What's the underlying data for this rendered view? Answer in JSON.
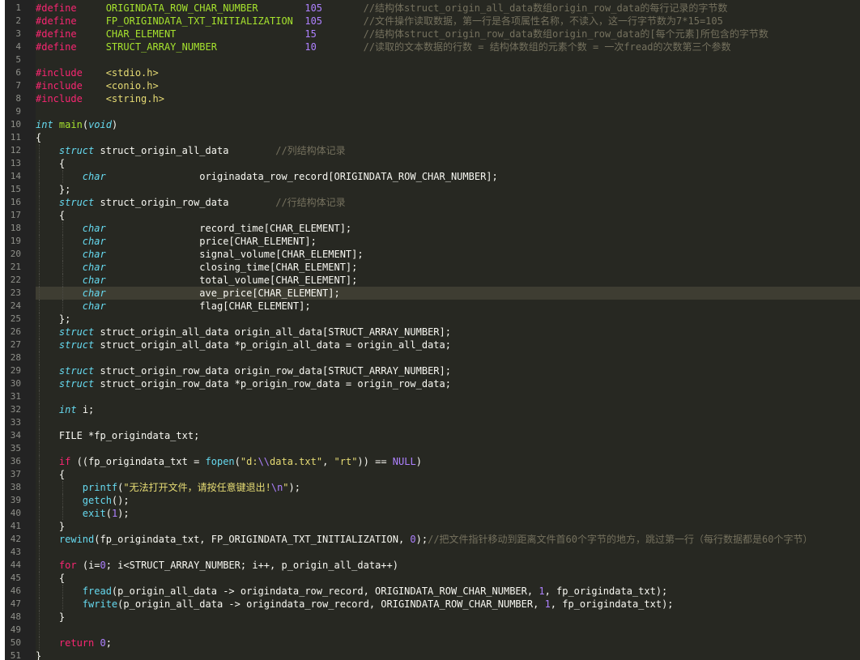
{
  "editor": {
    "highlighted_line": 23,
    "theme_colors": {
      "background": "#272822",
      "gutter": "#232323",
      "line_number": "#8f908a",
      "keyword": "#f92672",
      "type": "#66d9ef",
      "macro": "#a6e22e",
      "number": "#ae81ff",
      "string": "#e6db74",
      "comment": "#75715e",
      "text": "#f8f8f2"
    },
    "lines": [
      {
        "n": "1",
        "indent": 0,
        "tokens": [
          {
            "t": "k",
            "v": "#define"
          },
          {
            "t": "p",
            "v": "     "
          },
          {
            "t": "m",
            "v": "ORIGINDATA_ROW_CHAR_NUMBER"
          },
          {
            "t": "p",
            "v": "        "
          },
          {
            "t": "n",
            "v": "105"
          },
          {
            "t": "p",
            "v": "       "
          },
          {
            "t": "c",
            "v": "//结构体struct_origin_all_data数组origin_row_data的每行记录的字节数"
          }
        ]
      },
      {
        "n": "2",
        "indent": 0,
        "tokens": [
          {
            "t": "k",
            "v": "#define"
          },
          {
            "t": "p",
            "v": "     "
          },
          {
            "t": "m",
            "v": "FP_ORIGINDATA_TXT_INITIALIZATION"
          },
          {
            "t": "p",
            "v": "  "
          },
          {
            "t": "n",
            "v": "105"
          },
          {
            "t": "p",
            "v": "       "
          },
          {
            "t": "c",
            "v": "//文件操作读取数据，第一行是各项属性名称，不读入，这一行字节数为7*15=105"
          }
        ]
      },
      {
        "n": "3",
        "indent": 0,
        "tokens": [
          {
            "t": "k",
            "v": "#define"
          },
          {
            "t": "p",
            "v": "     "
          },
          {
            "t": "m",
            "v": "CHAR_ELEMENT"
          },
          {
            "t": "p",
            "v": "                      "
          },
          {
            "t": "n",
            "v": "15"
          },
          {
            "t": "p",
            "v": "        "
          },
          {
            "t": "c",
            "v": "//结构体struct_origin_row_data数组origin_row_data的[每个元素]所包含的字节数"
          }
        ]
      },
      {
        "n": "4",
        "indent": 0,
        "tokens": [
          {
            "t": "k",
            "v": "#define"
          },
          {
            "t": "p",
            "v": "     "
          },
          {
            "t": "m",
            "v": "STRUCT_ARRAY_NUMBER"
          },
          {
            "t": "p",
            "v": "               "
          },
          {
            "t": "n",
            "v": "10"
          },
          {
            "t": "p",
            "v": "        "
          },
          {
            "t": "c",
            "v": "//读取的文本数据的行数 = 结构体数组的元素个数 = 一次fread的次数第三个参数"
          }
        ]
      },
      {
        "n": "5",
        "indent": 0,
        "tokens": []
      },
      {
        "n": "6",
        "indent": 0,
        "tokens": [
          {
            "t": "k",
            "v": "#include"
          },
          {
            "t": "p",
            "v": "    "
          },
          {
            "t": "s",
            "v": "<stdio.h>"
          }
        ]
      },
      {
        "n": "7",
        "indent": 0,
        "tokens": [
          {
            "t": "k",
            "v": "#include"
          },
          {
            "t": "p",
            "v": "    "
          },
          {
            "t": "s",
            "v": "<conio.h>"
          }
        ]
      },
      {
        "n": "8",
        "indent": 0,
        "tokens": [
          {
            "t": "k",
            "v": "#include"
          },
          {
            "t": "p",
            "v": "    "
          },
          {
            "t": "s",
            "v": "<string.h>"
          }
        ]
      },
      {
        "n": "9",
        "indent": 0,
        "tokens": []
      },
      {
        "n": "10",
        "indent": 0,
        "tokens": [
          {
            "t": "ty",
            "v": "int"
          },
          {
            "t": "p",
            "v": " "
          },
          {
            "t": "m",
            "v": "main"
          },
          {
            "t": "p",
            "v": "("
          },
          {
            "t": "ty",
            "v": "void"
          },
          {
            "t": "p",
            "v": ")"
          }
        ]
      },
      {
        "n": "11",
        "indent": 0,
        "tokens": [
          {
            "t": "p",
            "v": "{"
          }
        ]
      },
      {
        "n": "12",
        "indent": 1,
        "tokens": [
          {
            "t": "p",
            "v": "    "
          },
          {
            "t": "ty",
            "v": "struct"
          },
          {
            "t": "p",
            "v": " struct_origin_all_data        "
          },
          {
            "t": "c",
            "v": "//列结构体记录"
          }
        ]
      },
      {
        "n": "13",
        "indent": 1,
        "tokens": [
          {
            "t": "p",
            "v": "    {"
          }
        ]
      },
      {
        "n": "14",
        "indent": 2,
        "tokens": [
          {
            "t": "p",
            "v": "        "
          },
          {
            "t": "ty",
            "v": "char"
          },
          {
            "t": "p",
            "v": "                originadata_row_record[ORIGINDATA_ROW_CHAR_NUMBER];"
          }
        ]
      },
      {
        "n": "15",
        "indent": 1,
        "tokens": [
          {
            "t": "p",
            "v": "    };"
          }
        ]
      },
      {
        "n": "16",
        "indent": 1,
        "tokens": [
          {
            "t": "p",
            "v": "    "
          },
          {
            "t": "ty",
            "v": "struct"
          },
          {
            "t": "p",
            "v": " struct_origin_row_data        "
          },
          {
            "t": "c",
            "v": "//行结构体记录"
          }
        ]
      },
      {
        "n": "17",
        "indent": 1,
        "tokens": [
          {
            "t": "p",
            "v": "    {"
          }
        ]
      },
      {
        "n": "18",
        "indent": 2,
        "tokens": [
          {
            "t": "p",
            "v": "        "
          },
          {
            "t": "ty",
            "v": "char"
          },
          {
            "t": "p",
            "v": "                record_time[CHAR_ELEMENT];"
          }
        ]
      },
      {
        "n": "19",
        "indent": 2,
        "tokens": [
          {
            "t": "p",
            "v": "        "
          },
          {
            "t": "ty",
            "v": "char"
          },
          {
            "t": "p",
            "v": "                price[CHAR_ELEMENT];"
          }
        ]
      },
      {
        "n": "20",
        "indent": 2,
        "tokens": [
          {
            "t": "p",
            "v": "        "
          },
          {
            "t": "ty",
            "v": "char"
          },
          {
            "t": "p",
            "v": "                signal_volume[CHAR_ELEMENT];"
          }
        ]
      },
      {
        "n": "21",
        "indent": 2,
        "tokens": [
          {
            "t": "p",
            "v": "        "
          },
          {
            "t": "ty",
            "v": "char"
          },
          {
            "t": "p",
            "v": "                closing_time[CHAR_ELEMENT];"
          }
        ]
      },
      {
        "n": "22",
        "indent": 2,
        "tokens": [
          {
            "t": "p",
            "v": "        "
          },
          {
            "t": "ty",
            "v": "char"
          },
          {
            "t": "p",
            "v": "                total_volume[CHAR_ELEMENT];"
          }
        ]
      },
      {
        "n": "23",
        "indent": 2,
        "tokens": [
          {
            "t": "p",
            "v": "        "
          },
          {
            "t": "ty",
            "v": "char"
          },
          {
            "t": "p",
            "v": "                ave_price[CHAR_ELEMENT];"
          }
        ]
      },
      {
        "n": "24",
        "indent": 2,
        "tokens": [
          {
            "t": "p",
            "v": "        "
          },
          {
            "t": "ty",
            "v": "char"
          },
          {
            "t": "p",
            "v": "                flag[CHAR_ELEMENT];"
          }
        ]
      },
      {
        "n": "25",
        "indent": 1,
        "tokens": [
          {
            "t": "p",
            "v": "    };"
          }
        ]
      },
      {
        "n": "26",
        "indent": 1,
        "tokens": [
          {
            "t": "p",
            "v": "    "
          },
          {
            "t": "ty",
            "v": "struct"
          },
          {
            "t": "p",
            "v": " struct_origin_all_data origin_all_data[STRUCT_ARRAY_NUMBER];"
          }
        ]
      },
      {
        "n": "27",
        "indent": 1,
        "tokens": [
          {
            "t": "p",
            "v": "    "
          },
          {
            "t": "ty",
            "v": "struct"
          },
          {
            "t": "p",
            "v": " struct_origin_all_data *p_origin_all_data = origin_all_data;"
          }
        ]
      },
      {
        "n": "28",
        "indent": 1,
        "tokens": []
      },
      {
        "n": "29",
        "indent": 1,
        "tokens": [
          {
            "t": "p",
            "v": "    "
          },
          {
            "t": "ty",
            "v": "struct"
          },
          {
            "t": "p",
            "v": " struct_origin_row_data origin_row_data[STRUCT_ARRAY_NUMBER];"
          }
        ]
      },
      {
        "n": "30",
        "indent": 1,
        "tokens": [
          {
            "t": "p",
            "v": "    "
          },
          {
            "t": "ty",
            "v": "struct"
          },
          {
            "t": "p",
            "v": " struct_origin_row_data *p_origin_row_data = origin_row_data;"
          }
        ]
      },
      {
        "n": "31",
        "indent": 1,
        "tokens": []
      },
      {
        "n": "32",
        "indent": 1,
        "tokens": [
          {
            "t": "p",
            "v": "    "
          },
          {
            "t": "ty",
            "v": "int"
          },
          {
            "t": "p",
            "v": " i;"
          }
        ]
      },
      {
        "n": "33",
        "indent": 1,
        "tokens": []
      },
      {
        "n": "34",
        "indent": 1,
        "tokens": [
          {
            "t": "p",
            "v": "    FILE *fp_origindata_txt;"
          }
        ]
      },
      {
        "n": "35",
        "indent": 1,
        "tokens": []
      },
      {
        "n": "36",
        "indent": 1,
        "tokens": [
          {
            "t": "p",
            "v": "    "
          },
          {
            "t": "k",
            "v": "if"
          },
          {
            "t": "p",
            "v": " ((fp_origindata_txt = "
          },
          {
            "t": "tb",
            "v": "fopen"
          },
          {
            "t": "p",
            "v": "("
          },
          {
            "t": "s",
            "v": "\"d:"
          },
          {
            "t": "n",
            "v": "\\\\"
          },
          {
            "t": "s",
            "v": "data.txt\""
          },
          {
            "t": "p",
            "v": ", "
          },
          {
            "t": "s",
            "v": "\"rt\""
          },
          {
            "t": "p",
            "v": ")) == "
          },
          {
            "t": "n",
            "v": "NULL"
          },
          {
            "t": "p",
            "v": ")"
          }
        ]
      },
      {
        "n": "37",
        "indent": 1,
        "tokens": [
          {
            "t": "p",
            "v": "    {"
          }
        ]
      },
      {
        "n": "38",
        "indent": 2,
        "tokens": [
          {
            "t": "p",
            "v": "        "
          },
          {
            "t": "tb",
            "v": "printf"
          },
          {
            "t": "p",
            "v": "("
          },
          {
            "t": "s",
            "v": "\"无法打开文件，请按任意键退出!"
          },
          {
            "t": "n",
            "v": "\\n"
          },
          {
            "t": "s",
            "v": "\""
          },
          {
            "t": "p",
            "v": ");"
          }
        ]
      },
      {
        "n": "39",
        "indent": 2,
        "tokens": [
          {
            "t": "p",
            "v": "        "
          },
          {
            "t": "tb",
            "v": "getch"
          },
          {
            "t": "p",
            "v": "();"
          }
        ]
      },
      {
        "n": "40",
        "indent": 2,
        "tokens": [
          {
            "t": "p",
            "v": "        "
          },
          {
            "t": "tb",
            "v": "exit"
          },
          {
            "t": "p",
            "v": "("
          },
          {
            "t": "n",
            "v": "1"
          },
          {
            "t": "p",
            "v": ");"
          }
        ]
      },
      {
        "n": "41",
        "indent": 1,
        "tokens": [
          {
            "t": "p",
            "v": "    }"
          }
        ]
      },
      {
        "n": "42",
        "indent": 1,
        "tokens": [
          {
            "t": "p",
            "v": "    "
          },
          {
            "t": "tb",
            "v": "rewind"
          },
          {
            "t": "p",
            "v": "(fp_origindata_txt, FP_ORIGINDATA_TXT_INITIALIZATION, "
          },
          {
            "t": "n",
            "v": "0"
          },
          {
            "t": "p",
            "v": ");"
          },
          {
            "t": "c",
            "v": "//把文件指针移动到距离文件首60个字节的地方，跳过第一行（每行数据都是60个字节）"
          }
        ]
      },
      {
        "n": "43",
        "indent": 1,
        "tokens": []
      },
      {
        "n": "44",
        "indent": 1,
        "tokens": [
          {
            "t": "p",
            "v": "    "
          },
          {
            "t": "k",
            "v": "for"
          },
          {
            "t": "p",
            "v": " (i="
          },
          {
            "t": "n",
            "v": "0"
          },
          {
            "t": "p",
            "v": "; i<STRUCT_ARRAY_NUMBER; i++, p_origin_all_data++)"
          }
        ]
      },
      {
        "n": "45",
        "indent": 1,
        "tokens": [
          {
            "t": "p",
            "v": "    {"
          }
        ]
      },
      {
        "n": "46",
        "indent": 2,
        "tokens": [
          {
            "t": "p",
            "v": "        "
          },
          {
            "t": "tb",
            "v": "fread"
          },
          {
            "t": "p",
            "v": "(p_origin_all_data -> origindata_row_record, ORIGINDATA_ROW_CHAR_NUMBER, "
          },
          {
            "t": "n",
            "v": "1"
          },
          {
            "t": "p",
            "v": ", fp_origindata_txt);"
          }
        ]
      },
      {
        "n": "47",
        "indent": 2,
        "tokens": [
          {
            "t": "p",
            "v": "        "
          },
          {
            "t": "tb",
            "v": "fwrite"
          },
          {
            "t": "p",
            "v": "(p_origin_all_data -> origindata_row_record, ORIGINDATA_ROW_CHAR_NUMBER, "
          },
          {
            "t": "n",
            "v": "1"
          },
          {
            "t": "p",
            "v": ", fp_origindata_txt);"
          }
        ]
      },
      {
        "n": "48",
        "indent": 1,
        "tokens": [
          {
            "t": "p",
            "v": "    }"
          }
        ]
      },
      {
        "n": "49",
        "indent": 1,
        "tokens": []
      },
      {
        "n": "50",
        "indent": 1,
        "tokens": [
          {
            "t": "p",
            "v": "    "
          },
          {
            "t": "k",
            "v": "return"
          },
          {
            "t": "p",
            "v": " "
          },
          {
            "t": "n",
            "v": "0"
          },
          {
            "t": "p",
            "v": ";"
          }
        ]
      },
      {
        "n": "51",
        "indent": 0,
        "tokens": [
          {
            "t": "p",
            "v": "}"
          }
        ]
      }
    ]
  }
}
